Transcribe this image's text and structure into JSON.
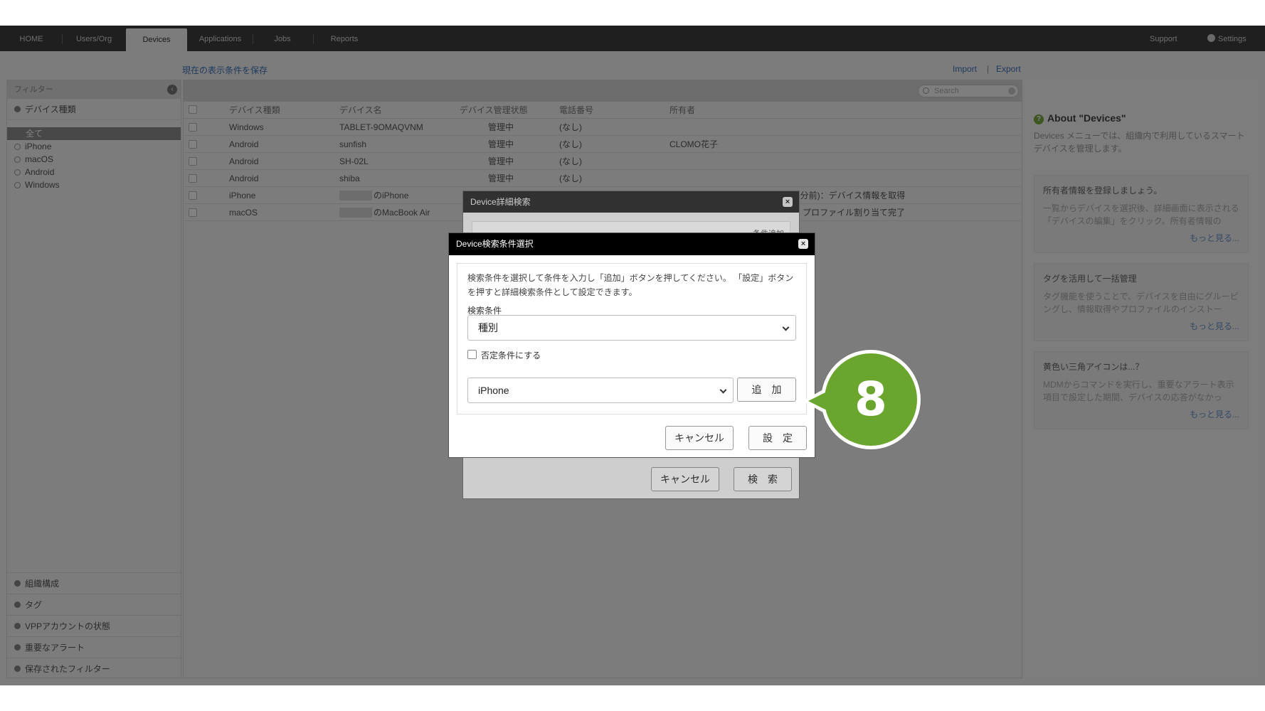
{
  "nav": {
    "tabs": [
      "HOME",
      "Users/Org",
      "Devices",
      "Applications",
      "Jobs",
      "Reports"
    ],
    "active": "Devices",
    "support": "Support",
    "settings": "Settings"
  },
  "links": {
    "save_view": "現在の表示条件を保存",
    "import": "Import",
    "separator": "|",
    "export": "Export"
  },
  "sidebar": {
    "header": "フィルター",
    "device_type": "デバイス種類",
    "items": [
      "全て",
      "iPhone",
      "macOS",
      "Android",
      "Windows"
    ],
    "bottom": [
      "組織構成",
      "タグ",
      "VPPアカウントの状態",
      "重要なアラート",
      "保存されたフィルター"
    ]
  },
  "table": {
    "search_placeholder": "Search",
    "headers": [
      "デバイス種類",
      "デバイス名",
      "デバイス管理状態",
      "電話番号",
      "所有者"
    ],
    "rows": [
      {
        "type": "Windows",
        "name": "TABLET-9OMAQVNM",
        "state": "管理中",
        "phone": "(なし)",
        "owner": ""
      },
      {
        "type": "Android",
        "name": "sunfish",
        "state": "管理中",
        "phone": "(なし)",
        "owner": "CLOMO花子"
      },
      {
        "type": "Android",
        "name": "SH-02L",
        "state": "管理中",
        "phone": "(なし)",
        "owner": ""
      },
      {
        "type": "Android",
        "name": "shiba",
        "state": "管理中",
        "phone": "(なし)",
        "owner": ""
      },
      {
        "type": "iPhone",
        "name": "のiPhone",
        "state": "",
        "phone": "",
        "owner": "",
        "note": "8分前)：デバイス情報を取得"
      },
      {
        "type": "macOS",
        "name": "のMacBook Air",
        "state": "",
        "phone": "",
        "owner": "",
        "note": "プロファイル割り当て完了"
      }
    ]
  },
  "about": {
    "title": "About \"Devices\"",
    "desc": "Devices メニューでは、組織内で利用しているスマートデバイスを管理します。",
    "cards": [
      {
        "title": "所有者情報を登録しましょう。",
        "text": "一覧からデバイスを選択後、詳細画面に表示される「デバイスの編集」をクリック。所有者情報の",
        "more": "もっと見る..."
      },
      {
        "title": "タグを活用して一括管理",
        "text": "タグ機能を使うことで、デバイスを自由にグルーピングし、情報取得やプロファイルのインストー",
        "more": "もっと見る..."
      },
      {
        "title": "黄色い三角アイコンは...？",
        "text": "MDMからコマンドを実行し、重要なアラート表示項目で設定した期間、デバイスの応答がなかっ",
        "more": "もっと見る..."
      }
    ]
  },
  "detail_dialog": {
    "title": "Device詳細検索",
    "add_condition": "条件追加",
    "cancel": "キャンセル",
    "search": "検　索"
  },
  "condition_dialog": {
    "title": "Device検索条件選択",
    "instructions": "検索条件を選択して条件を入力し「追加」ボタンを押してください。 「設定」ボタンを押すと詳細検索条件として設定できます。",
    "condition_label": "検索条件",
    "condition_value": "種別",
    "negate_label": "否定条件にする",
    "value_select": "iPhone",
    "add": "追　加",
    "cancel": "キャンセル",
    "set": "設　定"
  },
  "callout": {
    "step": "8",
    "color": "#6aa52e"
  }
}
